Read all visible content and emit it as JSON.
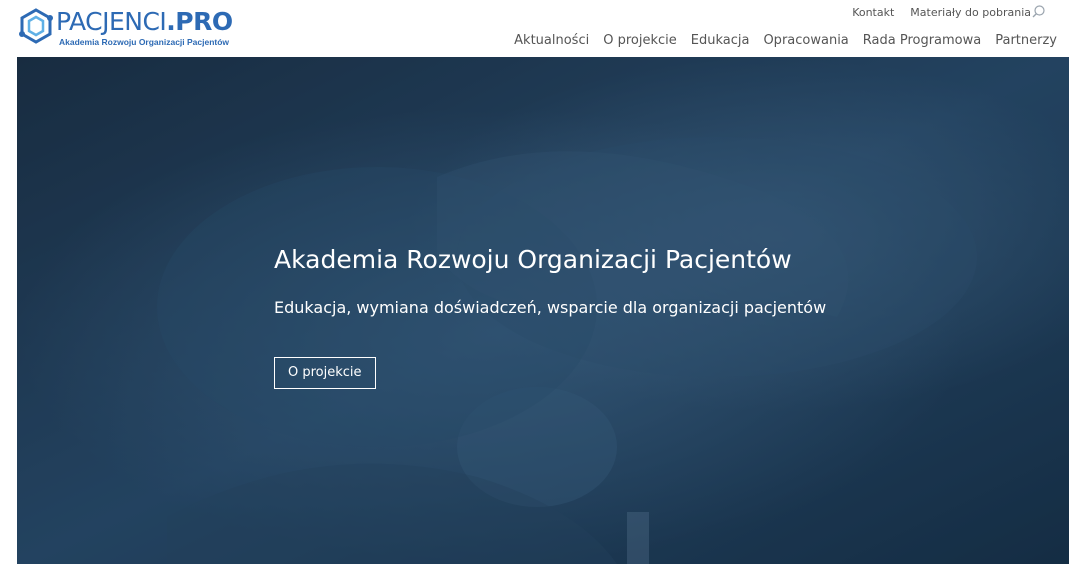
{
  "logo": {
    "name_light": "PACJENCI",
    "name_bold": ".PRO",
    "tagline": "Akademia Rozwoju Organizacji Pacjentów",
    "icon": "hexagon-link-icon",
    "color": "#2d6ab4"
  },
  "topbar": {
    "contact": "Kontakt",
    "downloads": "Materiały do pobrania",
    "search_icon": "search-icon"
  },
  "nav": {
    "items": [
      {
        "label": "Aktualności"
      },
      {
        "label": "O projekcie"
      },
      {
        "label": "Edukacja"
      },
      {
        "label": "Opracowania"
      },
      {
        "label": "Rada Programowa"
      },
      {
        "label": "Partnerzy"
      }
    ]
  },
  "hero": {
    "title": "Akademia Rozwoju Organizacji Pacjentów",
    "subtitle": "Edukacja, wymiana doświadczeń, wsparcie dla organizacji pacjentów",
    "button_label": "O projekcie",
    "overlay_color": "#1f3a57"
  }
}
